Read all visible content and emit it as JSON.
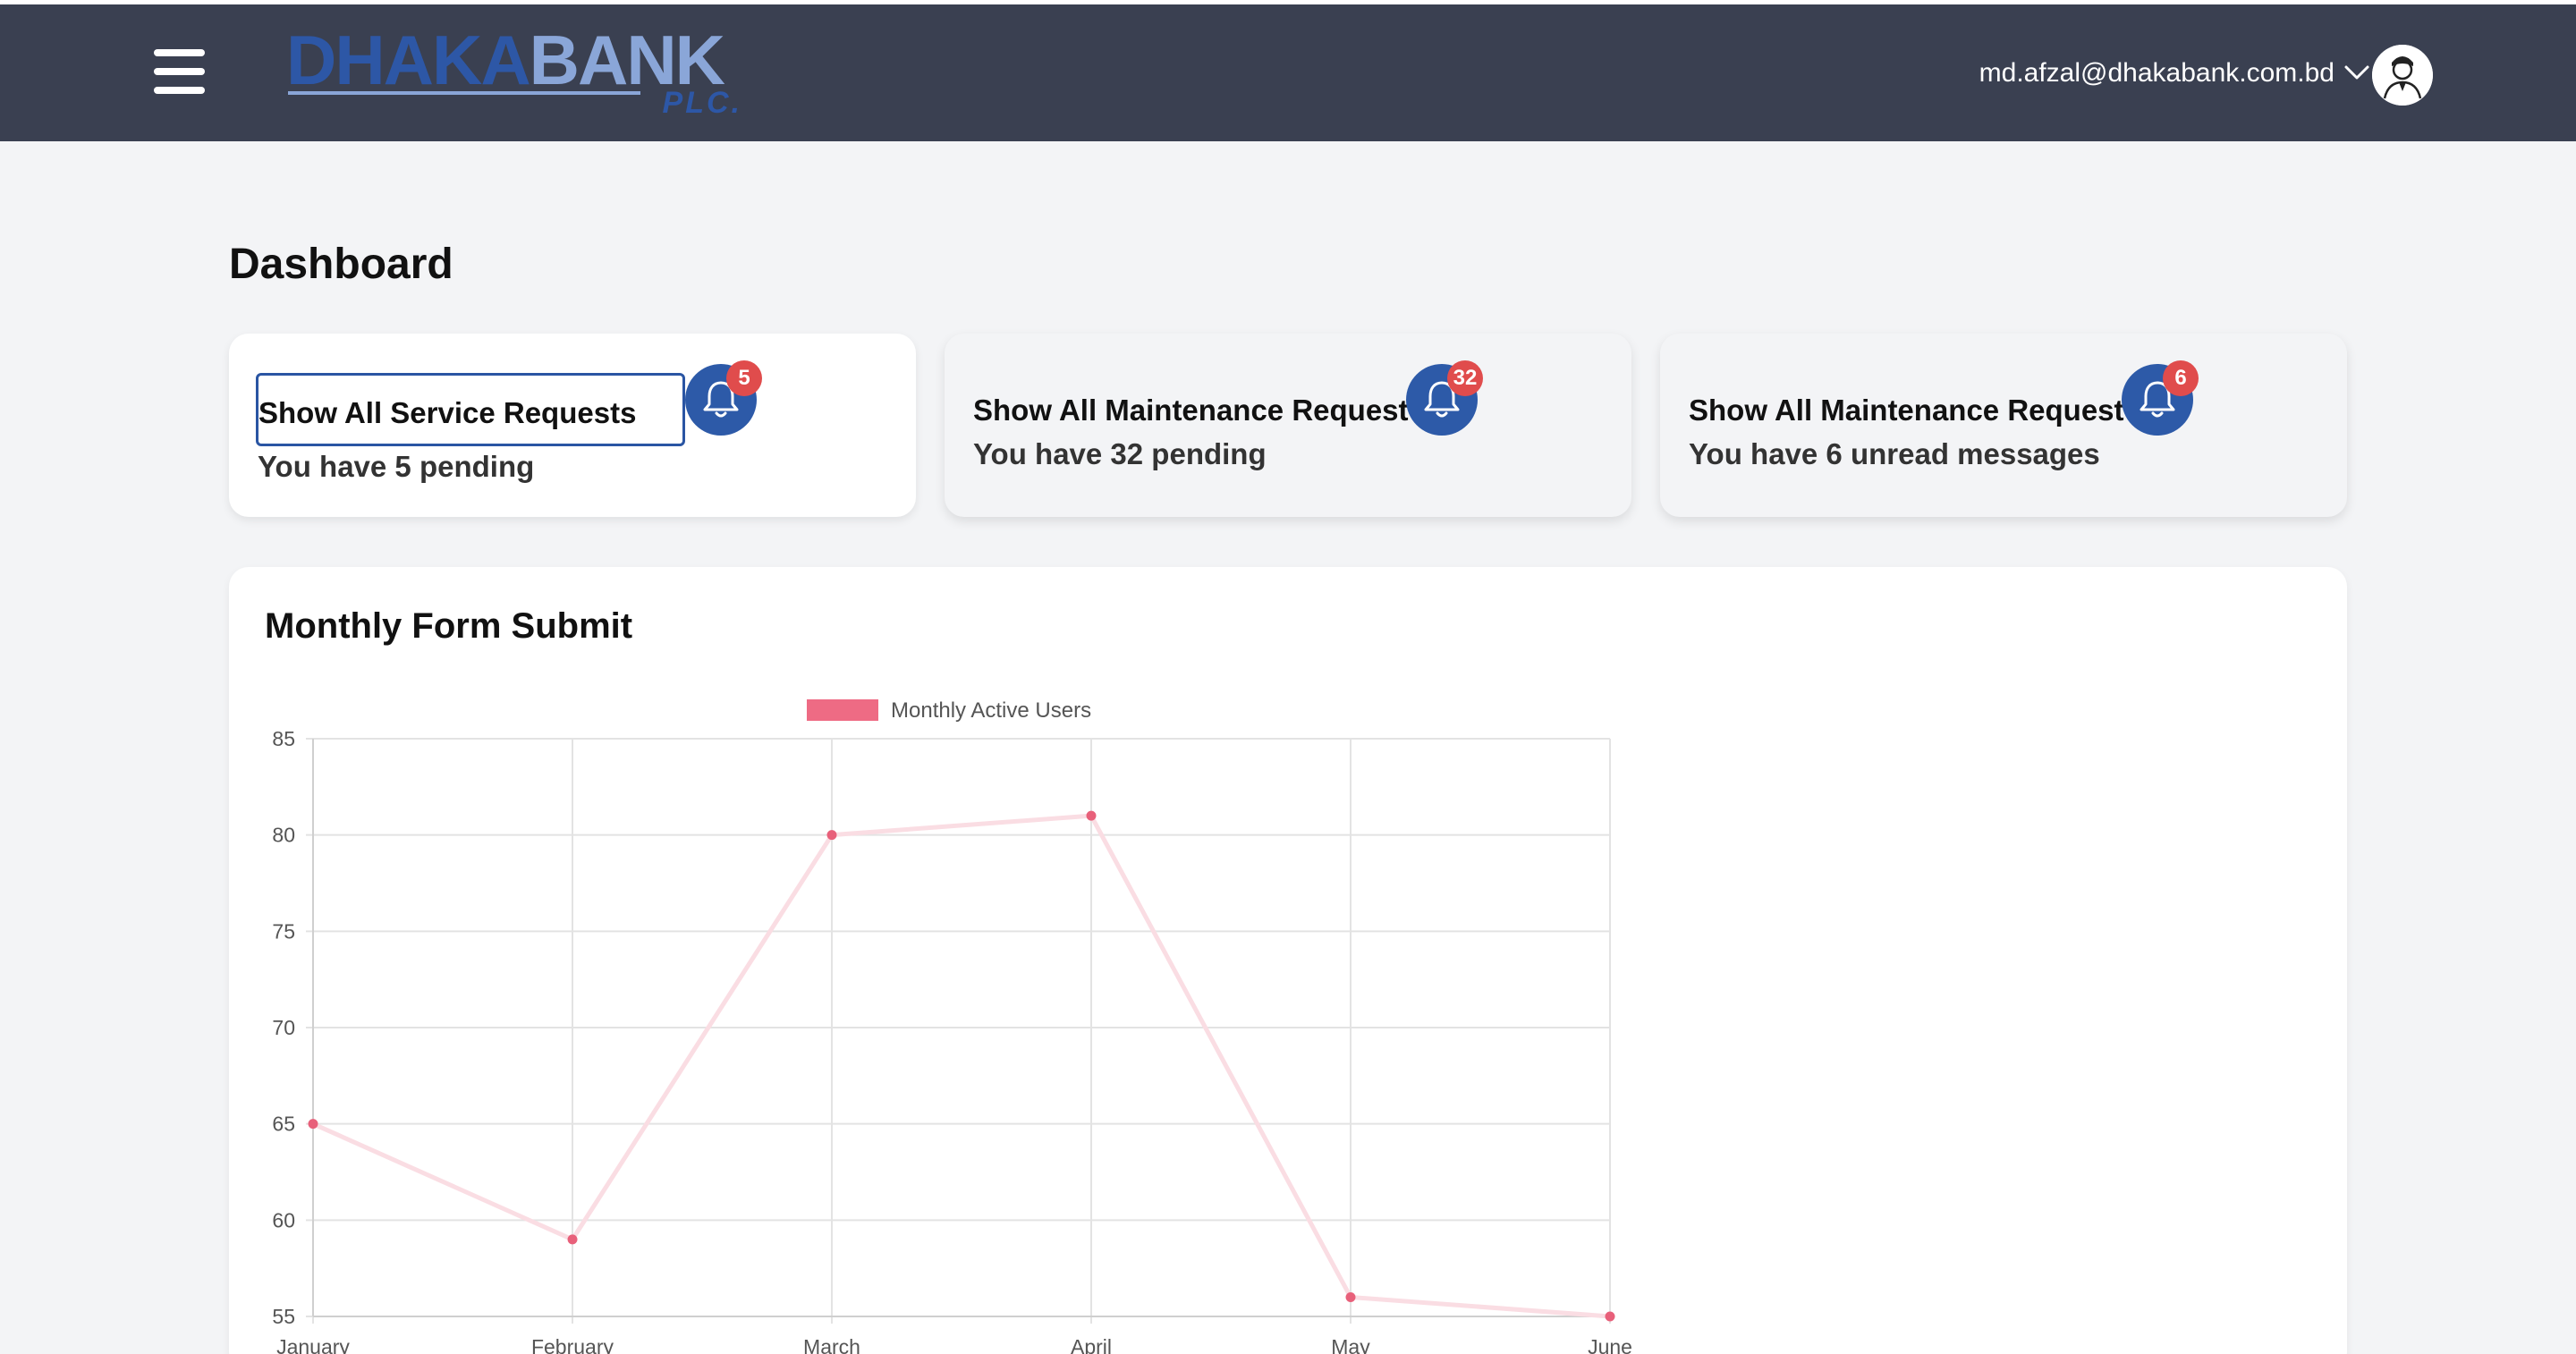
{
  "header": {
    "menu_icon": "hamburger-menu-icon",
    "logo": {
      "primary": "DHAKA",
      "secondary": "BANK",
      "suffix": "PLC."
    },
    "user_email": "md.afzal@dhakabank.com.bd",
    "dropdown_icon": "chevron-down-icon",
    "avatar_icon": "user-avatar-icon"
  },
  "page": {
    "title": "Dashboard"
  },
  "cards": [
    {
      "title": "Show All Service Requests",
      "subtitle": "You have 5 pending",
      "badge": "5",
      "icon": "bell-icon"
    },
    {
      "title": "Show All Maintenance Request",
      "subtitle": "You have 32 pending",
      "badge": "32",
      "icon": "bell-icon"
    },
    {
      "title": "Show All Maintenance Request",
      "subtitle": "You have 6 unread messages",
      "badge": "6",
      "icon": "bell-icon"
    }
  ],
  "chart_section": {
    "title": "Monthly Form Submit"
  },
  "colors": {
    "header_bg": "#3a4051",
    "accent_blue": "#2d5aa8",
    "badge_red": "#e04c4c",
    "series_point": "#e8607a",
    "series_line": "#fadde3",
    "legend_swatch": "#ee6b84"
  },
  "chart_data": {
    "type": "line",
    "title": "",
    "xlabel": "",
    "ylabel": "",
    "categories": [
      "January",
      "February",
      "March",
      "April",
      "May",
      "June"
    ],
    "series": [
      {
        "name": "Monthly Active Users",
        "values": [
          65,
          59,
          80,
          81,
          56,
          55
        ]
      }
    ],
    "ylim": [
      55,
      85
    ],
    "yticks": [
      55,
      60,
      65,
      70,
      75,
      80,
      85
    ],
    "grid": true,
    "legend_position": "top"
  }
}
